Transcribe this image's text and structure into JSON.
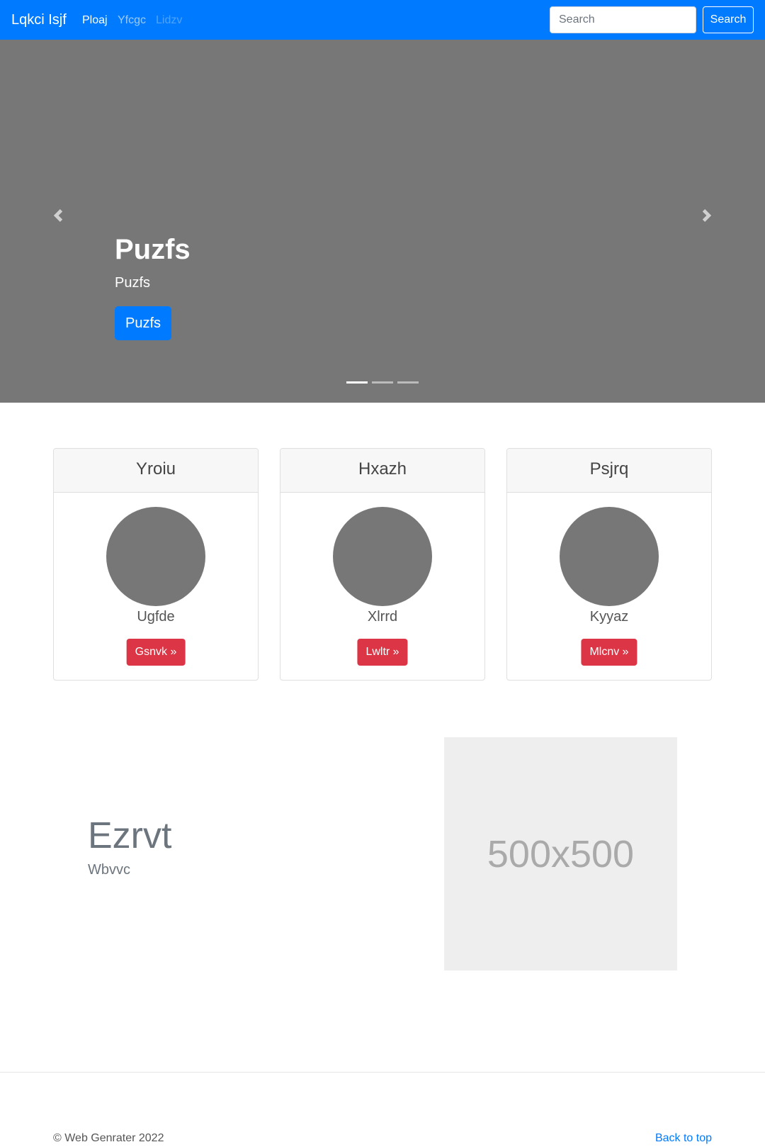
{
  "navbar": {
    "brand": "Lqkci Isjf",
    "links": [
      {
        "label": "Ploaj",
        "state": "active"
      },
      {
        "label": "Yfcgc",
        "state": "normal"
      },
      {
        "label": "Lidzv",
        "state": "disabled"
      }
    ],
    "search": {
      "placeholder": "Search",
      "value": "",
      "button_label": "Search"
    },
    "color": "#007bff"
  },
  "carousel": {
    "caption_title": "Puzfs",
    "caption_text": "Puzfs",
    "button_label": "Puzfs",
    "slide_count": 3,
    "active_slide": 1,
    "prev_icon": "chevron-left-icon",
    "next_icon": "chevron-right-icon",
    "background": "#777777"
  },
  "cards": [
    {
      "header": "Yroiu",
      "name": "Ugfde",
      "button_label": "Gsnvk »"
    },
    {
      "header": "Hxazh",
      "name": "Xlrrd",
      "button_label": "Lwltr »"
    },
    {
      "header": "Psjrq",
      "name": "Kyyaz",
      "button_label": "Mlcnv »"
    }
  ],
  "feature": {
    "title": "Ezrvt",
    "subtitle": "Wbvvc",
    "image_label": "500x500"
  },
  "footer": {
    "copyright": "© Web Genrater 2022",
    "back_to_top": "Back to top"
  },
  "colors": {
    "primary": "#007bff",
    "danger": "#dc3545",
    "muted": "#6c757d"
  }
}
